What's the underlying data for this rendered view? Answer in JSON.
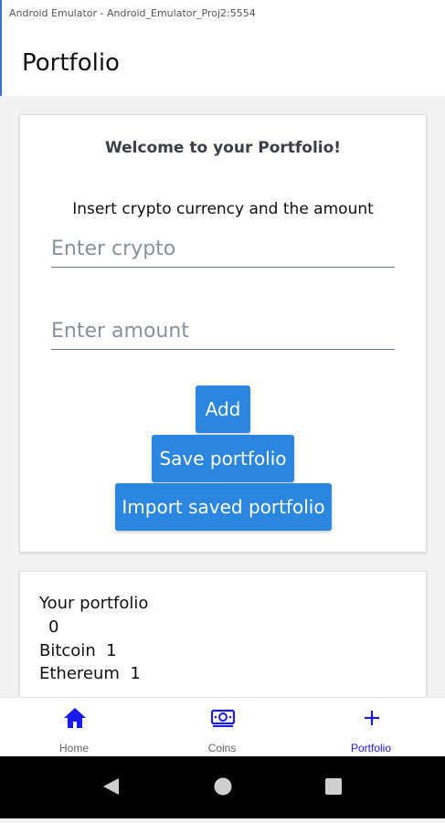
{
  "window": {
    "title": "Android Emulator - Android_Emulator_Proj2:5554"
  },
  "appbar": {
    "title": "Portfolio"
  },
  "form": {
    "heading": "Welcome to your Portfolio!",
    "instruction": "Insert crypto currency and the amount",
    "crypto_placeholder": "Enter crypto",
    "amount_placeholder": "Enter amount",
    "add_label": "Add",
    "save_label": "Save portfolio",
    "import_label": "Import saved portfolio"
  },
  "portfolio": {
    "title": "Your portfolio",
    "total": "0",
    "items": [
      {
        "text": "Bitcoin  1"
      },
      {
        "text": "Ethereum  1"
      }
    ]
  },
  "nav": {
    "items": [
      {
        "label": "Home",
        "icon": "home-icon",
        "active": false
      },
      {
        "label": "Coins",
        "icon": "coins-icon",
        "active": false
      },
      {
        "label": "Portfolio",
        "icon": "plus-icon",
        "active": true
      }
    ]
  },
  "colors": {
    "accent": "#2a86de",
    "nav_icon": "#1a1aee",
    "nav_active": "#1a1aee",
    "nav_inactive": "#666666"
  }
}
